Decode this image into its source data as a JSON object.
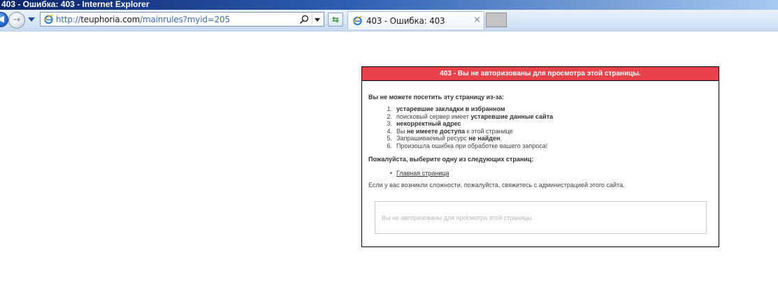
{
  "window": {
    "title": "403 - Ошибка: 403 - Internet Explorer"
  },
  "navigation": {
    "address": {
      "prefix": "http://",
      "host": "teuphoria.com",
      "path": "/mainrules?myid=205"
    },
    "tab": {
      "title": "403 - Ошибка: 403",
      "close": "×"
    }
  },
  "error_page": {
    "header": "403 - Вы не авторизованы для просмотра этой страницы.",
    "lead": "Вы не можете посетить эту страницу из-за:",
    "reasons": [
      {
        "num": "1.",
        "before": "",
        "bold": "устаревшие закладки в избранном",
        "after": ""
      },
      {
        "num": "2.",
        "before": "поисковый сервер имеет ",
        "bold": "устаревшие данные сайта",
        "after": ""
      },
      {
        "num": "3.",
        "before": "",
        "bold": "некорректный адрес",
        "after": ""
      },
      {
        "num": "4.",
        "before": "Вы ",
        "bold": "не имеете доступа",
        "after": " к этой странице"
      },
      {
        "num": "5.",
        "before": "Запрашиваемый ресурс ",
        "bold": "не найден",
        "after": "."
      },
      {
        "num": "6.",
        "before": "Произошла ошибка при обработке вашего запроса!",
        "bold": "",
        "after": ""
      }
    ],
    "choose": "Пожалуйста, выберите одну из следующих страниц:",
    "link_bullet": "•",
    "home_link": "Главная страница",
    "contact": "Если у вас возникли сложности, пожалуйста, свяжитесь с администрацией этого сайта.",
    "message_box": "Вы не авторизованы для просмотра этой страницы."
  },
  "colors": {
    "header_bg": "#e8434a",
    "titlebar_start": "#0a246a",
    "link_color": "#3b6fb6"
  }
}
